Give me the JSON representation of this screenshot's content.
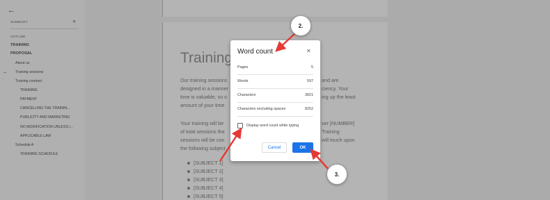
{
  "sidebar": {
    "summary_label": "SUMMARY",
    "outline_label": "OUTLINE",
    "items": [
      {
        "label": "TRAINING",
        "bold": true
      },
      {
        "label": "PROPOSAL",
        "bold": true
      },
      {
        "label": "About us",
        "bold": false
      },
      {
        "label": "Training sessions",
        "bold": false
      },
      {
        "label": "Training contract",
        "bold": false
      },
      {
        "label": "TRAINING",
        "bold": false
      },
      {
        "label": "PAYMENT",
        "bold": false
      },
      {
        "label": "CANCELLING THE TRAININ...",
        "bold": false
      },
      {
        "label": "PUBLICITY AND MARKETING",
        "bold": false
      },
      {
        "label": "NO MODIFICATION UNLESS I...",
        "bold": false
      },
      {
        "label": "APPLICABLE LAW",
        "bold": false
      },
      {
        "label": "Schedule A",
        "bold": false
      },
      {
        "label": "TRAINING SCHEDULE",
        "bold": false
      }
    ]
  },
  "document": {
    "title": "Training",
    "para1": [
      "Our training sessions",
      "designed in a manner",
      "time is valuable, so o",
      "amount of your time"
    ],
    "para1_right": [
      "and are",
      "ciency. Your",
      "ing up the least"
    ],
    "para2": [
      "Your training will be",
      "of total sessions tha",
      "sessions will be con",
      "the following subject"
    ],
    "para2_right": [
      "ver [NUMBER]",
      "Training",
      "will touch upon"
    ],
    "bullets": [
      "[SUBJECT 1]",
      "[SUBJECT 2]",
      "[SUBJECT 3]",
      "[SUBJECT 4]",
      "[SUBJECT 5]"
    ]
  },
  "dialog": {
    "title": "Word count",
    "stats": [
      {
        "label": "Pages",
        "value": "5"
      },
      {
        "label": "Words",
        "value": "597"
      },
      {
        "label": "Characters",
        "value": "3821"
      },
      {
        "label": "Characters excluding spaces",
        "value": "8252"
      }
    ],
    "checkbox_label": "Display word count while typing",
    "checkbox_checked": false,
    "cancel_label": "Cancel",
    "ok_label": "OK"
  },
  "annotations": {
    "callouts": [
      "2.",
      "3."
    ],
    "arrow_color": "#e53935"
  }
}
